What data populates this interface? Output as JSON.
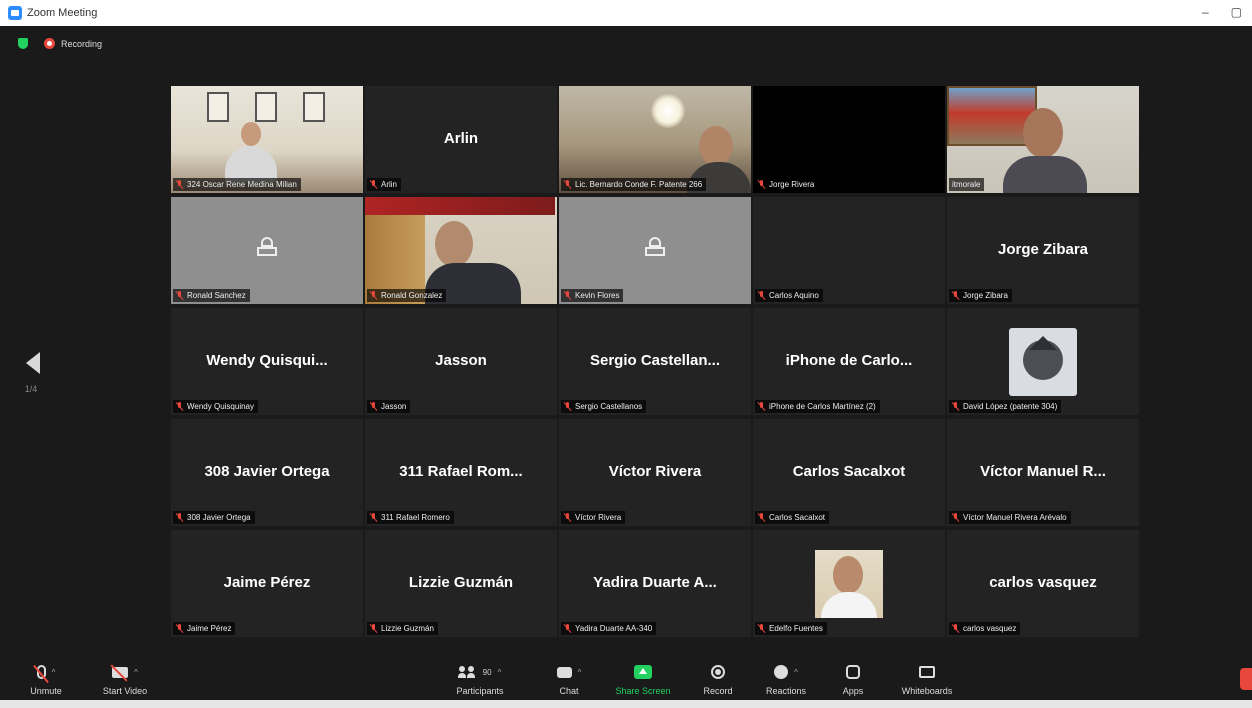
{
  "window": {
    "title": "Zoom Meeting",
    "minimize": "–",
    "restore": "▢"
  },
  "status": {
    "recording": "Recording"
  },
  "pager": {
    "label": "1/4"
  },
  "tiles": [
    {
      "label": "324 Oscar Rene Medina Milian",
      "display": "",
      "video": "office"
    },
    {
      "label": "Arlin",
      "display": "Arlin",
      "video": ""
    },
    {
      "label": "Lic. Bernardo Conde F. Patente 266",
      "display": "",
      "video": "room"
    },
    {
      "label": "Jorge Rivera",
      "display": "",
      "video": "black"
    },
    {
      "label": "itmorale",
      "display": "",
      "video": "street",
      "active": true
    },
    {
      "label": "Ronald Sanchez",
      "display": "",
      "video": "grey"
    },
    {
      "label": "Ronald Gonzalez",
      "display": "",
      "video": "gonzalez"
    },
    {
      "label": "Kevin Flores",
      "display": "",
      "video": "grey"
    },
    {
      "label": "Carlos Aquino",
      "display": "",
      "video": ""
    },
    {
      "label": "Jorge Zibara",
      "display": "Jorge Zibara",
      "video": ""
    },
    {
      "label": "Wendy Quisquinay",
      "display": "Wendy  Quisqui...",
      "video": ""
    },
    {
      "label": "Jasson",
      "display": "Jasson",
      "video": ""
    },
    {
      "label": "Sergio Castellanos",
      "display": "Sergio  Castellan...",
      "video": ""
    },
    {
      "label": "iPhone de Carlos Martínez (2)",
      "display": "iPhone  de  Carlo...",
      "video": ""
    },
    {
      "label": "David López (patente 304)",
      "display": "",
      "video": "avatar"
    },
    {
      "label": "308 Javier Ortega",
      "display": "308 Javier Ortega",
      "video": ""
    },
    {
      "label": "311 Rafael Romero",
      "display": "311  Rafael  Rom...",
      "video": ""
    },
    {
      "label": "Víctor Rivera",
      "display": "Víctor Rivera",
      "video": ""
    },
    {
      "label": "Carlos Sacalxot",
      "display": "Carlos Sacalxot",
      "video": ""
    },
    {
      "label": "Víctor Manuel Rivera Arévalo",
      "display": "Víctor  Manuel  R...",
      "video": ""
    },
    {
      "label": "Jaime Pérez",
      "display": "Jaime Pérez",
      "video": ""
    },
    {
      "label": "Lizzie Guzmán",
      "display": "Lizzie Guzmán",
      "video": ""
    },
    {
      "label": "Yadira Duarte AA-340",
      "display": "Yadira  Duarte  A...",
      "video": ""
    },
    {
      "label": "Edelfo Fuentes",
      "display": "",
      "video": "edelfo"
    },
    {
      "label": "carlos vasquez",
      "display": "carlos vasquez",
      "video": ""
    }
  ],
  "toolbar": {
    "unmute": "Unmute",
    "start_video": "Start Video",
    "participants": "Participants",
    "participant_count": "90",
    "chat": "Chat",
    "share_screen": "Share Screen",
    "record": "Record",
    "reactions": "Reactions",
    "apps": "Apps",
    "whiteboards": "Whiteboards"
  },
  "colors": {
    "accent_green": "#23d160",
    "record_red": "#e8473c",
    "active_speaker": "#c8e25a",
    "zoom_blue": "#2d8cff"
  }
}
